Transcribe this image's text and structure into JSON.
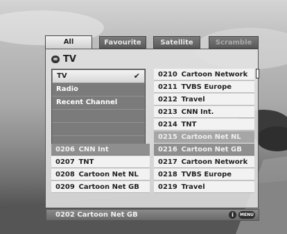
{
  "tabs": [
    "All",
    "Favourite",
    "Satellite",
    "Scramble"
  ],
  "title": "TV",
  "groups": [
    "TV",
    "Radio",
    "Recent Channel",
    "",
    "",
    ""
  ],
  "channels_right": [
    {
      "num": "0210",
      "name": "Cartoon Network"
    },
    {
      "num": "0211",
      "name": "TVBS Europe"
    },
    {
      "num": "0212",
      "name": "Travel"
    },
    {
      "num": "0213",
      "name": "CNN Int."
    },
    {
      "num": "0214",
      "name": "TNT"
    },
    {
      "num": "0215",
      "name": "Cartoon Net NL"
    },
    {
      "num": "0216",
      "name": "Cartoon Net GB"
    },
    {
      "num": "0217",
      "name": "Cartoon Network"
    },
    {
      "num": "0218",
      "name": "TVBS Europe"
    },
    {
      "num": "0219",
      "name": "Travel"
    }
  ],
  "channels_left": [
    {
      "num": "0206",
      "name": "CNN Int"
    },
    {
      "num": "0207",
      "name": "TNT"
    },
    {
      "num": "0208",
      "name": "Cartoon Net NL"
    },
    {
      "num": "0209",
      "name": "Cartoon Net GB"
    }
  ],
  "status": {
    "current": "0202  Cartoon Net GB",
    "menu_label": "MENU",
    "info_label": "i"
  }
}
